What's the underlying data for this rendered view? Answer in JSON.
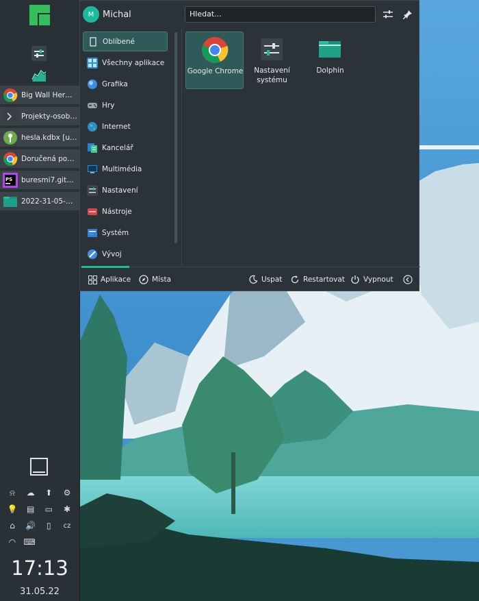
{
  "colors": {
    "accent": "#1abc9c",
    "panel": "#2a3136",
    "launcher": "#2c3338"
  },
  "panel": {
    "logo_icon": "manjaro-logo-icon",
    "launchers": [
      {
        "icon": "settings-icon"
      },
      {
        "icon": "system-monitor-icon"
      }
    ],
    "tasks": [
      {
        "label": "Big Wall Herm...",
        "icon": "chrome-icon"
      },
      {
        "label": "Projekty-osobn...",
        "icon": "terminal-icon"
      },
      {
        "label": "hesla.kdbx [uz...",
        "icon": "keepassxc-icon"
      },
      {
        "label": "Doručená pošt...",
        "icon": "chrome-icon"
      },
      {
        "label": "buresmi7.gith...",
        "icon": "phpstorm-icon"
      },
      {
        "label": "2022-31-05-mu...",
        "icon": "folder-icon"
      }
    ],
    "tray": [
      [
        "⍾",
        "☁",
        "⬆",
        "⚙"
      ],
      [
        "💡",
        "▤",
        "▭",
        "✱"
      ],
      [
        "⌂",
        "🔊",
        "▯",
        "cz"
      ],
      [
        "◠",
        "⌨",
        "",
        ""
      ]
    ],
    "clock": "17:13",
    "date": "31.05.22"
  },
  "launcher": {
    "avatar_letter": "M",
    "username": "Michal",
    "search_value": "Hledat...",
    "categories": [
      {
        "label": "Oblíbené",
        "icon": "bookmark-icon"
      },
      {
        "label": "Všechny aplikace",
        "icon": "all-apps-icon"
      },
      {
        "label": "Grafika",
        "icon": "graphics-icon"
      },
      {
        "label": "Hry",
        "icon": "games-icon"
      },
      {
        "label": "Internet",
        "icon": "internet-icon"
      },
      {
        "label": "Kancelář",
        "icon": "office-icon"
      },
      {
        "label": "Multimédia",
        "icon": "multimedia-icon"
      },
      {
        "label": "Nastavení",
        "icon": "settings-icon"
      },
      {
        "label": "Nástroje",
        "icon": "tools-icon"
      },
      {
        "label": "Systém",
        "icon": "system-icon"
      },
      {
        "label": "Vývoj",
        "icon": "development-icon"
      }
    ],
    "apps": [
      {
        "label": "Google Chrome",
        "icon": "chrome-icon"
      },
      {
        "label": "Nastavení systému",
        "icon": "system-settings-icon"
      },
      {
        "label": "Dolphin",
        "icon": "dolphin-icon"
      }
    ],
    "footer": {
      "apps_tab": "Aplikace",
      "places_tab": "Místa",
      "sleep": "Uspat",
      "restart": "Restartovat",
      "shutdown": "Vypnout"
    }
  }
}
